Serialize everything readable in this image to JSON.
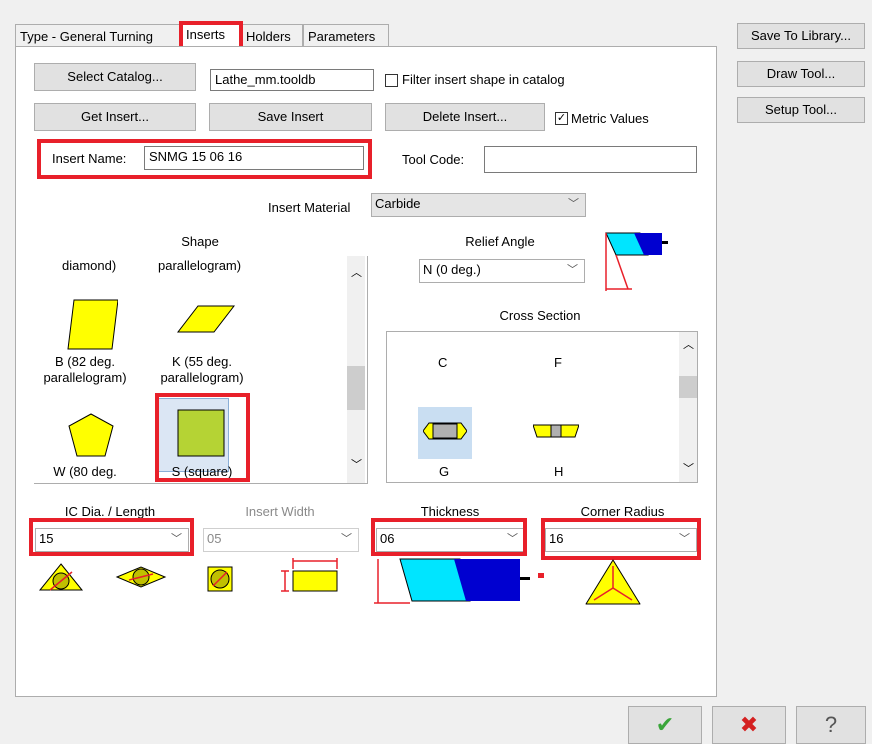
{
  "tabs": [
    {
      "label": "Type - General Turning"
    },
    {
      "label": "Inserts"
    },
    {
      "label": "Holders"
    },
    {
      "label": "Parameters"
    }
  ],
  "side_buttons": {
    "save_to_library": "Save To Library...",
    "draw_tool": "Draw Tool...",
    "setup_tool": "Setup Tool..."
  },
  "catalog": {
    "select_catalog_label": "Select Catalog...",
    "catalog_file": "Lathe_mm.tooldb",
    "filter_label": "Filter insert shape in catalog",
    "filter_checked": false
  },
  "insert_buttons": {
    "get_insert": "Get Insert...",
    "save_insert": "Save Insert",
    "delete_insert": "Delete Insert...",
    "metric_label": "Metric Values",
    "metric_checked": true
  },
  "insert_name": {
    "label": "Insert Name:",
    "value": "SNMG 15 06 16"
  },
  "tool_code": {
    "label": "Tool Code:",
    "value": ""
  },
  "insert_material": {
    "label": "Insert Material",
    "value": "Carbide"
  },
  "shape": {
    "title": "Shape",
    "partial_items": [
      "diamond)",
      "parallelogram)"
    ],
    "items": [
      {
        "label": "B (82 deg.\nparallelogram)"
      },
      {
        "label": "K (55 deg.\nparallelogram)"
      },
      {
        "label": "W (80 deg."
      },
      {
        "label": "S (square)"
      }
    ]
  },
  "relief_angle": {
    "title": "Relief Angle",
    "value": "N (0 deg.)"
  },
  "cross_section": {
    "title": "Cross Section",
    "items": [
      {
        "label": "C"
      },
      {
        "label": "F"
      },
      {
        "label": "G"
      },
      {
        "label": "H"
      }
    ]
  },
  "ic_dia": {
    "label": "IC Dia. / Length",
    "value": "15"
  },
  "insert_width": {
    "label": "Insert Width",
    "value": "05"
  },
  "thickness": {
    "label": "Thickness",
    "value": "06"
  },
  "corner_radius": {
    "label": "Corner Radius",
    "value": "16"
  },
  "bottom_buttons": {
    "ok": "✔",
    "cancel": "✖",
    "help": "?"
  },
  "colors": {
    "highlight_red": "#e8202a",
    "insert_yellow": "#ffff00",
    "square_green": "#b5d334",
    "cyan": "#00e5ff",
    "blue": "#0000d0"
  }
}
